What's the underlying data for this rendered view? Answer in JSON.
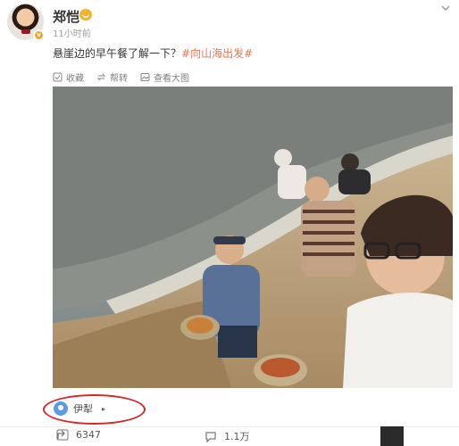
{
  "header": {
    "username": "郑恺",
    "timestamp": "11小时前",
    "avatar_badge": "v",
    "more_icon": "chevron-down-icon"
  },
  "post": {
    "text": "悬崖边的早午餐了解一下？",
    "topic": "#向山海出发#"
  },
  "actions": {
    "favorite": "收藏",
    "repost": "帮转",
    "view_large": "查看大图"
  },
  "location": {
    "name": "伊犁",
    "chevron": "▸"
  },
  "stats": {
    "reposts": "6347",
    "comments": "1.1万"
  },
  "colors": {
    "topic": "#eb7350",
    "highlight_oval": "#d9262a",
    "location_pin": "#5b9be3",
    "vip_badge": "#f3b12c"
  }
}
